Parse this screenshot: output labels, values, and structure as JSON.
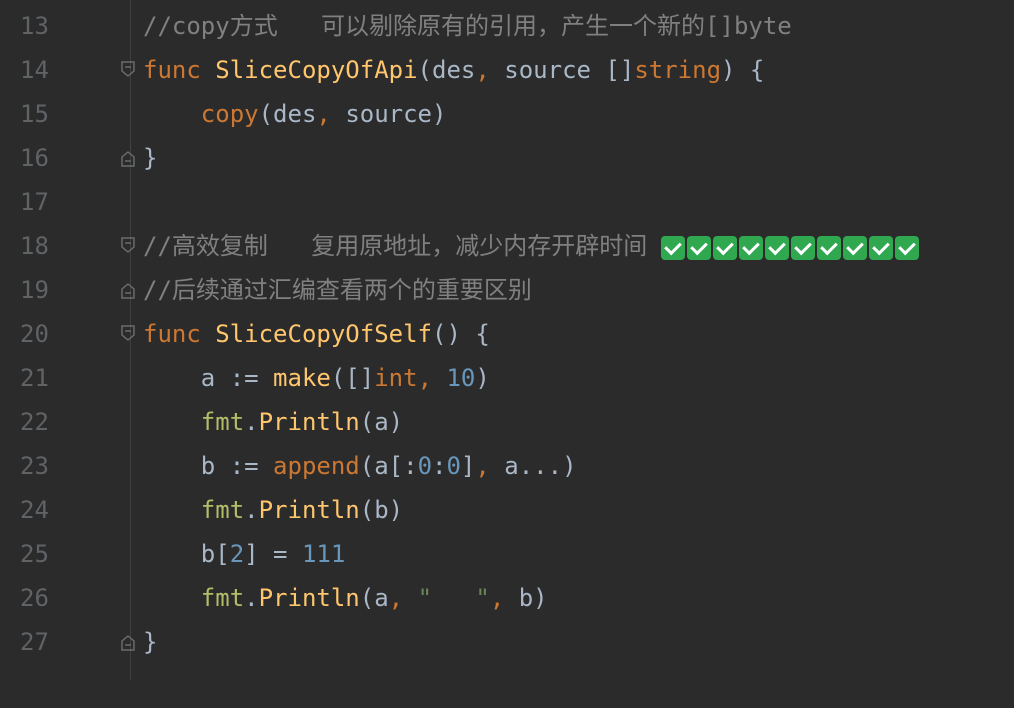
{
  "editor": {
    "lines": [
      {
        "num": "13",
        "tokens": [
          {
            "c": "cm",
            "t": "//copy方式   可以剔除原有的引用，产生一个新的[]byte"
          }
        ]
      },
      {
        "num": "14",
        "fold": "start",
        "tokens": [
          {
            "c": "kw",
            "t": "func "
          },
          {
            "c": "fn",
            "t": "SliceCopyOfApi"
          },
          {
            "c": "pl",
            "t": "("
          },
          {
            "c": "id",
            "t": "des"
          },
          {
            "c": "kw",
            "t": ", "
          },
          {
            "c": "id",
            "t": "source "
          },
          {
            "c": "pl",
            "t": "[]"
          },
          {
            "c": "ty",
            "t": "string"
          },
          {
            "c": "pl",
            "t": ") {"
          }
        ]
      },
      {
        "num": "15",
        "tokens": [
          {
            "c": "pl",
            "t": "    "
          },
          {
            "c": "kw",
            "t": "copy"
          },
          {
            "c": "pl",
            "t": "("
          },
          {
            "c": "id",
            "t": "des"
          },
          {
            "c": "kw",
            "t": ", "
          },
          {
            "c": "id",
            "t": "source"
          },
          {
            "c": "pl",
            "t": ")"
          }
        ]
      },
      {
        "num": "16",
        "fold": "end",
        "tokens": [
          {
            "c": "pl",
            "t": "}"
          }
        ]
      },
      {
        "num": "17",
        "tokens": []
      },
      {
        "num": "18",
        "fold": "start",
        "checks": 10,
        "tokens": [
          {
            "c": "cm",
            "t": "//高效复制   复用原地址，减少内存开辟时间"
          }
        ]
      },
      {
        "num": "19",
        "fold": "end",
        "tokens": [
          {
            "c": "cm",
            "t": "//后续通过汇编查看两个的重要区别"
          }
        ]
      },
      {
        "num": "20",
        "fold": "start",
        "tokens": [
          {
            "c": "kw",
            "t": "func "
          },
          {
            "c": "fn",
            "t": "SliceCopyOfSelf"
          },
          {
            "c": "pl",
            "t": "() {"
          }
        ]
      },
      {
        "num": "21",
        "tokens": [
          {
            "c": "pl",
            "t": "    "
          },
          {
            "c": "id",
            "t": "a := "
          },
          {
            "c": "bi",
            "t": "make"
          },
          {
            "c": "pl",
            "t": "([]"
          },
          {
            "c": "ty",
            "t": "int"
          },
          {
            "c": "kw",
            "t": ", "
          },
          {
            "c": "num",
            "t": "10"
          },
          {
            "c": "pl",
            "t": ")"
          }
        ]
      },
      {
        "num": "22",
        "tokens": [
          {
            "c": "pl",
            "t": "    "
          },
          {
            "c": "pkg",
            "t": "fmt"
          },
          {
            "c": "pl",
            "t": "."
          },
          {
            "c": "fn",
            "t": "Println"
          },
          {
            "c": "pl",
            "t": "(a)"
          }
        ]
      },
      {
        "num": "23",
        "tokens": [
          {
            "c": "pl",
            "t": "    "
          },
          {
            "c": "id",
            "t": "b := "
          },
          {
            "c": "kw",
            "t": "append"
          },
          {
            "c": "pl",
            "t": "(a["
          },
          {
            "c": "pl",
            "t": ":"
          },
          {
            "c": "num",
            "t": "0"
          },
          {
            "c": "pl",
            "t": ":"
          },
          {
            "c": "num",
            "t": "0"
          },
          {
            "c": "pl",
            "t": "]"
          },
          {
            "c": "kw",
            "t": ", "
          },
          {
            "c": "pl",
            "t": "a...)"
          }
        ]
      },
      {
        "num": "24",
        "tokens": [
          {
            "c": "pl",
            "t": "    "
          },
          {
            "c": "pkg",
            "t": "fmt"
          },
          {
            "c": "pl",
            "t": "."
          },
          {
            "c": "fn",
            "t": "Println"
          },
          {
            "c": "pl",
            "t": "(b)"
          }
        ]
      },
      {
        "num": "25",
        "tokens": [
          {
            "c": "pl",
            "t": "    "
          },
          {
            "c": "id",
            "t": "b["
          },
          {
            "c": "num",
            "t": "2"
          },
          {
            "c": "id",
            "t": "] = "
          },
          {
            "c": "num",
            "t": "111"
          }
        ]
      },
      {
        "num": "26",
        "tokens": [
          {
            "c": "pl",
            "t": "    "
          },
          {
            "c": "pkg",
            "t": "fmt"
          },
          {
            "c": "pl",
            "t": "."
          },
          {
            "c": "fn",
            "t": "Println"
          },
          {
            "c": "pl",
            "t": "(a"
          },
          {
            "c": "kw",
            "t": ", "
          },
          {
            "c": "str",
            "t": "\"   \""
          },
          {
            "c": "kw",
            "t": ", "
          },
          {
            "c": "pl",
            "t": "b)"
          }
        ]
      },
      {
        "num": "27",
        "fold": "end",
        "tokens": [
          {
            "c": "pl",
            "t": "}"
          }
        ]
      }
    ]
  },
  "colors": {
    "background": "#2b2b2b",
    "keyword": "#cc7832",
    "function": "#ffc66d",
    "number": "#6897bb",
    "comment": "#808080",
    "string": "#6a8759",
    "checkmark": "#2fa84f"
  },
  "icons": {
    "fold_start": "fold-start-icon",
    "fold_end": "fold-end-icon",
    "checkmark": "check-mark-emoji-icon"
  }
}
